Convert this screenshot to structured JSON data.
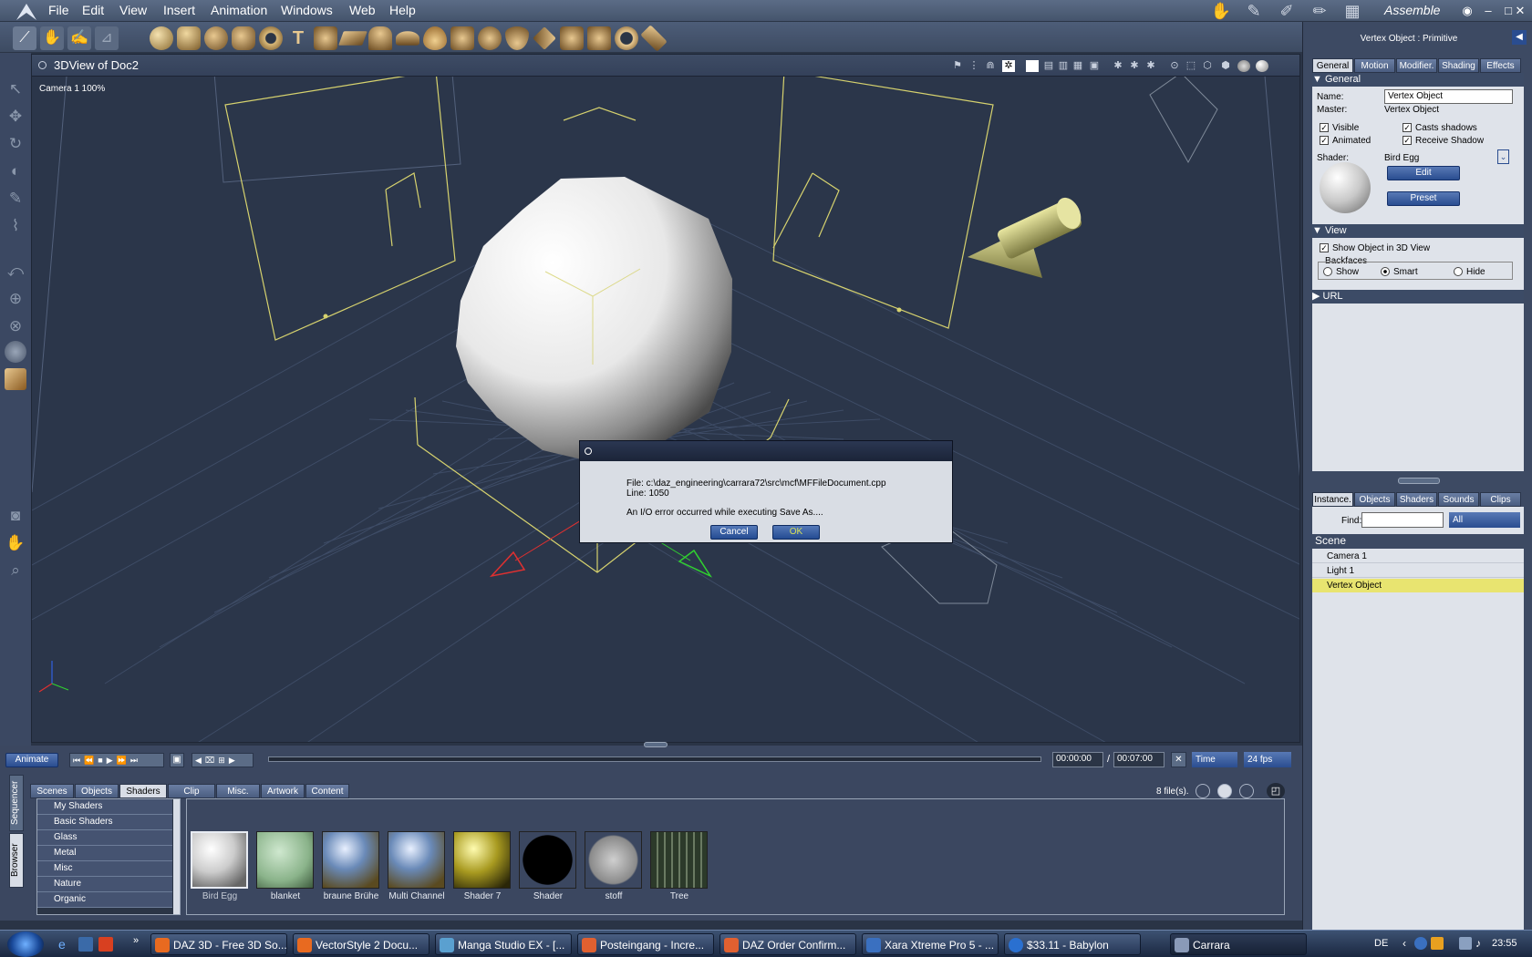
{
  "menubar": {
    "items": [
      "File",
      "Edit",
      "View",
      "Insert",
      "Animation",
      "Windows",
      "Web",
      "Help"
    ],
    "room_label": "Assemble"
  },
  "view": {
    "title": "3DView of Doc2",
    "camera_label": "Camera 1 100%"
  },
  "dialog": {
    "file_line": "File: c:\\daz_engineering\\carrara72\\src\\mcf\\MFFileDocument.cpp",
    "line_line": "Line: 1050",
    "message": "An I/O error occurred while executing Save As....",
    "cancel_label": "Cancel",
    "ok_label": "OK"
  },
  "properties": {
    "header": "Vertex Object : Primitive",
    "tabs": [
      "General",
      "Motion",
      "Modifier.",
      "Shading",
      "Effects"
    ],
    "general_section": "General",
    "name_label": "Name:",
    "name_value": "Vertex Object",
    "master_label": "Master:",
    "master_value": "Vertex Object",
    "visible": "Visible",
    "casts_shadows": "Casts shadows",
    "animated": "Animated",
    "receive_shadow": "Receive Shadow",
    "shader_label": "Shader:",
    "shader_value": "Bird Egg",
    "edit_label": "Edit",
    "preset_label": "Preset",
    "view_section": "View",
    "show_in_3d": "Show Object in 3D View",
    "backfaces": "Backfaces",
    "show": "Show",
    "smart": "Smart",
    "hide": "Hide",
    "url_section": "URL"
  },
  "instances": {
    "tabs": [
      "Instance.",
      "Objects",
      "Shaders",
      "Sounds",
      "Clips"
    ],
    "find_label": "Find:",
    "filter_value": "All",
    "scene_label": "Scene",
    "items": [
      "Camera 1",
      "Light 1",
      "Vertex Object"
    ]
  },
  "timeline": {
    "animate_label": "Animate",
    "time_start": "00:00:00",
    "separator": "/",
    "time_end": "00:07:00",
    "time_mode": "Time",
    "fps": "24 fps"
  },
  "browser": {
    "side_tabs": [
      "Sequencer",
      "Browser"
    ],
    "tabs": [
      "Scenes",
      "Objects",
      "Shaders",
      "Clip",
      "Misc.",
      "Artwork",
      "Content"
    ],
    "file_count": "8 file(s).",
    "categories": [
      "My Shaders",
      "Basic Shaders",
      "Glass",
      "Metal",
      "Misc",
      "Nature",
      "Organic"
    ],
    "thumbnails": [
      "Bird Egg",
      "blanket",
      "braune Brühe",
      "Multi Channel",
      "Shader 7",
      "Shader",
      "stoff",
      "Tree"
    ]
  },
  "taskbar": {
    "buttons": [
      "DAZ 3D - Free 3D So...",
      "VectorStyle 2 Docu...",
      "Manga Studio EX - [...",
      "Posteingang - Incre...",
      "DAZ Order Confirm...",
      "Xara Xtreme Pro 5 - ...",
      "$33.11 - Babylon",
      "Carrara"
    ],
    "language": "DE",
    "clock": "23:55"
  },
  "colors": {
    "viewport_bg": "#2b364a",
    "selection_yellow": "#e6e07a",
    "dialog_btn": "#2a4d90"
  }
}
